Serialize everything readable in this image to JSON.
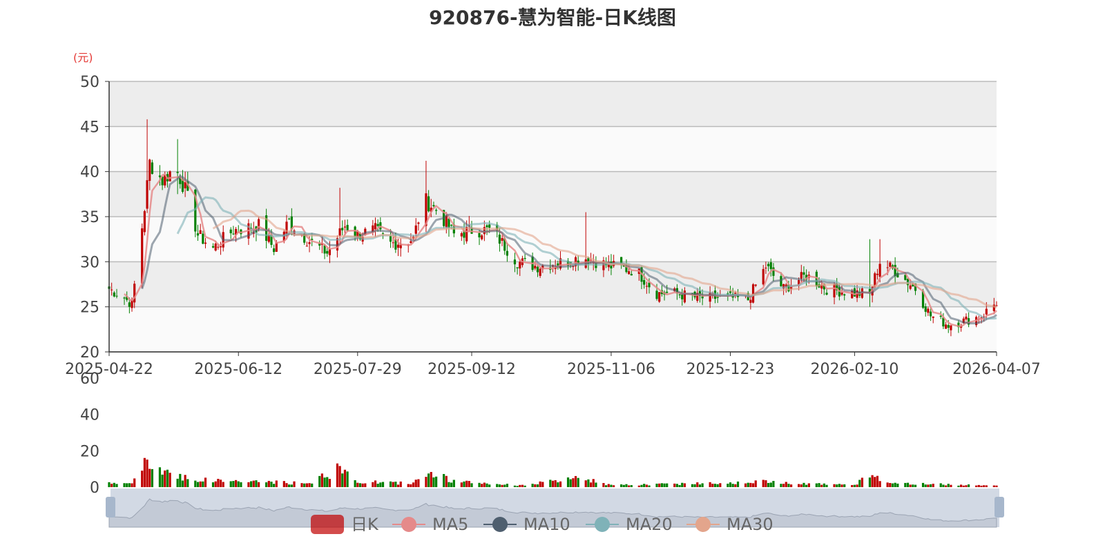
{
  "chart_data": {
    "type": "candlestick",
    "title": "920876-慧为智能-日K线图",
    "price_unit": "(元)",
    "price_axis": {
      "ylim": [
        20,
        50
      ],
      "ticks": [
        "50",
        "45",
        "40",
        "35",
        "30",
        "25",
        "20"
      ]
    },
    "volume_axis": {
      "ylim": [
        0,
        60
      ],
      "ticks": [
        "60",
        "40",
        "20",
        "0"
      ]
    },
    "x_tick_labels": [
      "2025-04-22",
      "2025-06-12",
      "2025-07-29",
      "2025-09-12",
      "2025-11-06",
      "2025-12-23",
      "2026-02-10",
      "2026-04-07"
    ],
    "x_range": [
      "2025-04-22",
      "2026-04-07"
    ],
    "grid": "horizontal",
    "legend_placement": "bottom-center",
    "legend": [
      "日K",
      "MA5",
      "MA10",
      "MA20",
      "MA30"
    ],
    "colors": {
      "up": "#c00000",
      "down": "#008000",
      "MA5": "#e58a8a",
      "MA10": "#4f5f6f",
      "MA20": "#7fb2b8",
      "MA30": "#e3a58c",
      "zoom_fill": "#d2d9e4",
      "zoom_handle": "#a7b7cc"
    },
    "close_anchors": [
      {
        "date": "2025-04-22",
        "close": 27.0
      },
      {
        "date": "2025-04-28",
        "close": 26.0
      },
      {
        "date": "2025-05-01",
        "close": 25.3
      },
      {
        "date": "2025-05-06",
        "close": 36.0
      },
      {
        "date": "2025-05-08",
        "close": 41.0
      },
      {
        "date": "2025-05-13",
        "close": 39.0
      },
      {
        "date": "2025-05-18",
        "close": 40.5
      },
      {
        "date": "2025-05-22",
        "close": 38.0
      },
      {
        "date": "2025-05-27",
        "close": 33.0
      },
      {
        "date": "2025-06-02",
        "close": 31.5
      },
      {
        "date": "2025-06-10",
        "close": 33.5
      },
      {
        "date": "2025-06-20",
        "close": 34.0
      },
      {
        "date": "2025-06-26",
        "close": 31.5
      },
      {
        "date": "2025-07-02",
        "close": 34.5
      },
      {
        "date": "2025-07-09",
        "close": 32.5
      },
      {
        "date": "2025-07-17",
        "close": 31.0
      },
      {
        "date": "2025-07-24",
        "close": 34.0
      },
      {
        "date": "2025-07-29",
        "close": 33.0
      },
      {
        "date": "2025-08-05",
        "close": 33.5
      },
      {
        "date": "2025-08-11",
        "close": 32.0
      },
      {
        "date": "2025-08-20",
        "close": 32.5
      },
      {
        "date": "2025-08-24",
        "close": 37.0
      },
      {
        "date": "2025-08-30",
        "close": 35.5
      },
      {
        "date": "2025-09-05",
        "close": 33.0
      },
      {
        "date": "2025-09-12",
        "close": 33.5
      },
      {
        "date": "2025-09-20",
        "close": 33.5
      },
      {
        "date": "2025-09-30",
        "close": 30.0
      },
      {
        "date": "2025-10-08",
        "close": 29.5
      },
      {
        "date": "2025-10-18",
        "close": 30.0
      },
      {
        "date": "2025-10-26",
        "close": 30.5
      },
      {
        "date": "2025-11-06",
        "close": 29.5
      },
      {
        "date": "2025-11-16",
        "close": 29.0
      },
      {
        "date": "2025-11-24",
        "close": 26.5
      },
      {
        "date": "2025-12-01",
        "close": 26.5
      },
      {
        "date": "2025-12-10",
        "close": 26.0
      },
      {
        "date": "2025-12-23",
        "close": 26.0
      },
      {
        "date": "2025-12-30",
        "close": 25.8
      },
      {
        "date": "2026-01-06",
        "close": 29.5
      },
      {
        "date": "2026-01-13",
        "close": 27.0
      },
      {
        "date": "2026-01-22",
        "close": 28.5
      },
      {
        "date": "2026-01-30",
        "close": 27.0
      },
      {
        "date": "2026-02-10",
        "close": 26.5
      },
      {
        "date": "2026-02-16",
        "close": 26.5
      },
      {
        "date": "2026-02-20",
        "close": 30.0
      },
      {
        "date": "2026-02-26",
        "close": 29.0
      },
      {
        "date": "2026-03-06",
        "close": 27.0
      },
      {
        "date": "2026-03-12",
        "close": 24.0
      },
      {
        "date": "2026-03-19",
        "close": 23.0
      },
      {
        "date": "2026-03-26",
        "close": 23.5
      },
      {
        "date": "2026-04-01",
        "close": 24.0
      },
      {
        "date": "2026-04-07",
        "close": 25.5
      }
    ],
    "volume_anchors": [
      {
        "date": "2025-04-22",
        "volume": 2
      },
      {
        "date": "2025-05-01",
        "volume": 2
      },
      {
        "date": "2025-05-06",
        "volume": 12
      },
      {
        "date": "2025-05-10",
        "volume": 11
      },
      {
        "date": "2025-05-16",
        "volume": 8
      },
      {
        "date": "2025-05-26",
        "volume": 4
      },
      {
        "date": "2025-06-20",
        "volume": 3
      },
      {
        "date": "2025-07-09",
        "volume": 2
      },
      {
        "date": "2025-07-22",
        "volume": 10
      },
      {
        "date": "2025-07-29",
        "volume": 3
      },
      {
        "date": "2025-08-20",
        "volume": 2
      },
      {
        "date": "2025-08-24",
        "volume": 10
      },
      {
        "date": "2025-09-05",
        "volume": 3
      },
      {
        "date": "2025-10-01",
        "volume": 1
      },
      {
        "date": "2025-10-26",
        "volume": 5
      },
      {
        "date": "2025-11-06",
        "volume": 1
      },
      {
        "date": "2026-01-06",
        "volume": 3
      },
      {
        "date": "2026-02-10",
        "volume": 1
      },
      {
        "date": "2026-02-16",
        "volume": 7
      },
      {
        "date": "2026-02-26",
        "volume": 2
      },
      {
        "date": "2026-04-07",
        "volume": 1
      }
    ],
    "spikes": [
      {
        "date": "2025-05-07",
        "high": 45.8,
        "low": 38.5
      },
      {
        "date": "2025-05-19",
        "high": 43.6,
        "low": 37.5
      },
      {
        "date": "2025-07-22",
        "high": 38.2,
        "low": 32.0
      },
      {
        "date": "2025-08-24",
        "high": 41.2,
        "low": 34.0
      },
      {
        "date": "2025-10-26",
        "high": 35.5,
        "low": 30.5
      },
      {
        "date": "2026-02-16",
        "high": 32.5,
        "low": 25.0
      },
      {
        "date": "2026-02-20",
        "high": 32.5,
        "low": 28.5
      }
    ]
  }
}
